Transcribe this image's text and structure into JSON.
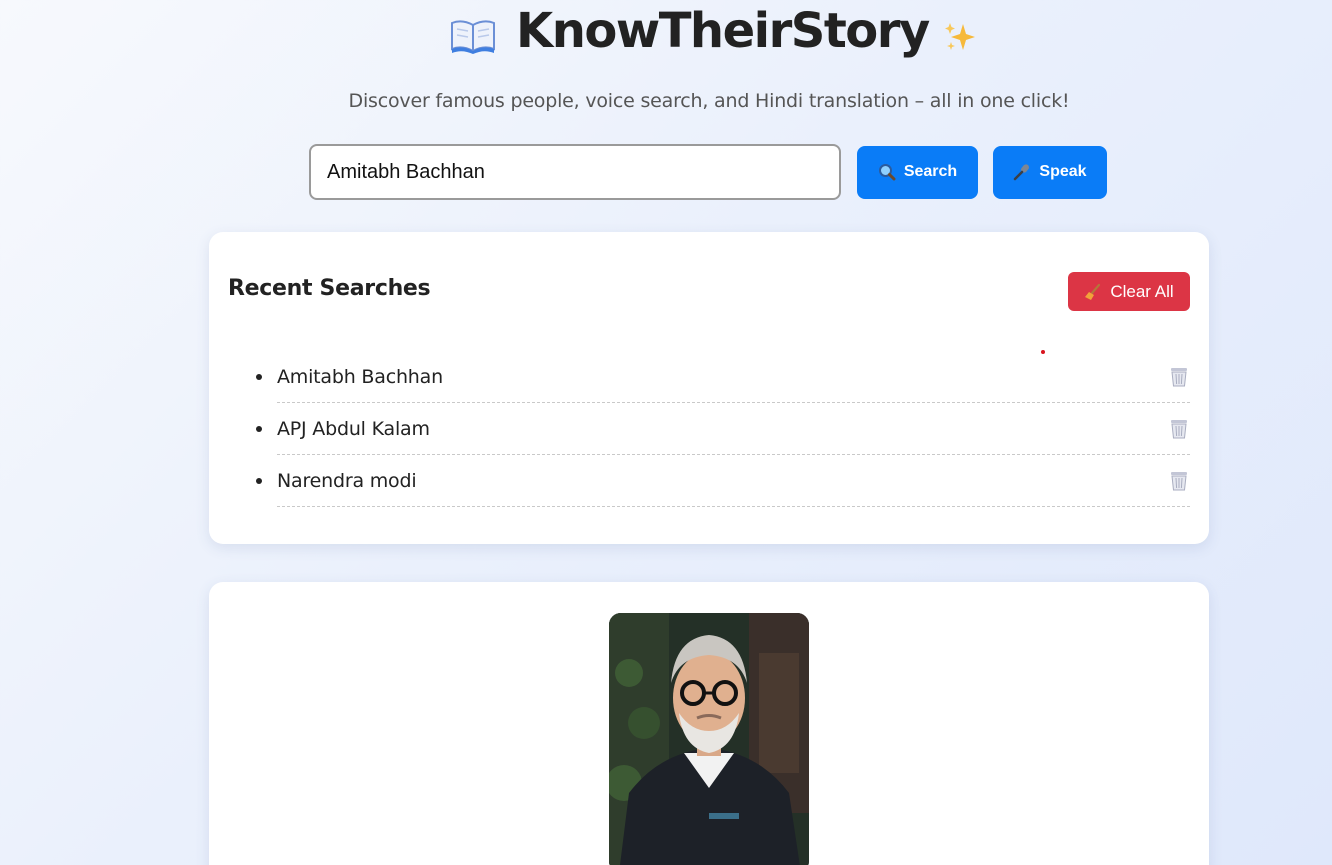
{
  "header": {
    "title": "KnowTheirStory",
    "subtitle": "Discover famous people, voice search, and Hindi translation – all in one click!",
    "title_icon": "open-book-icon",
    "title_trailing_icon": "sparkles-icon"
  },
  "search": {
    "value": "Amitabh Bachhan",
    "search_label": "Search",
    "search_icon": "magnifier-icon",
    "speak_label": "Speak",
    "speak_icon": "microphone-icon",
    "accent": "#0a7cf7"
  },
  "recent": {
    "title": "Recent Searches",
    "clear_label": "Clear All",
    "clear_icon": "broom-icon",
    "clear_color": "#dc3545",
    "items": [
      {
        "label": "Amitabh Bachhan",
        "icon": "trash-icon"
      },
      {
        "label": "APJ Abdul Kalam",
        "icon": "trash-icon"
      },
      {
        "label": "Narendra modi",
        "icon": "trash-icon"
      }
    ]
  },
  "profile": {
    "photo": "person-photo"
  }
}
